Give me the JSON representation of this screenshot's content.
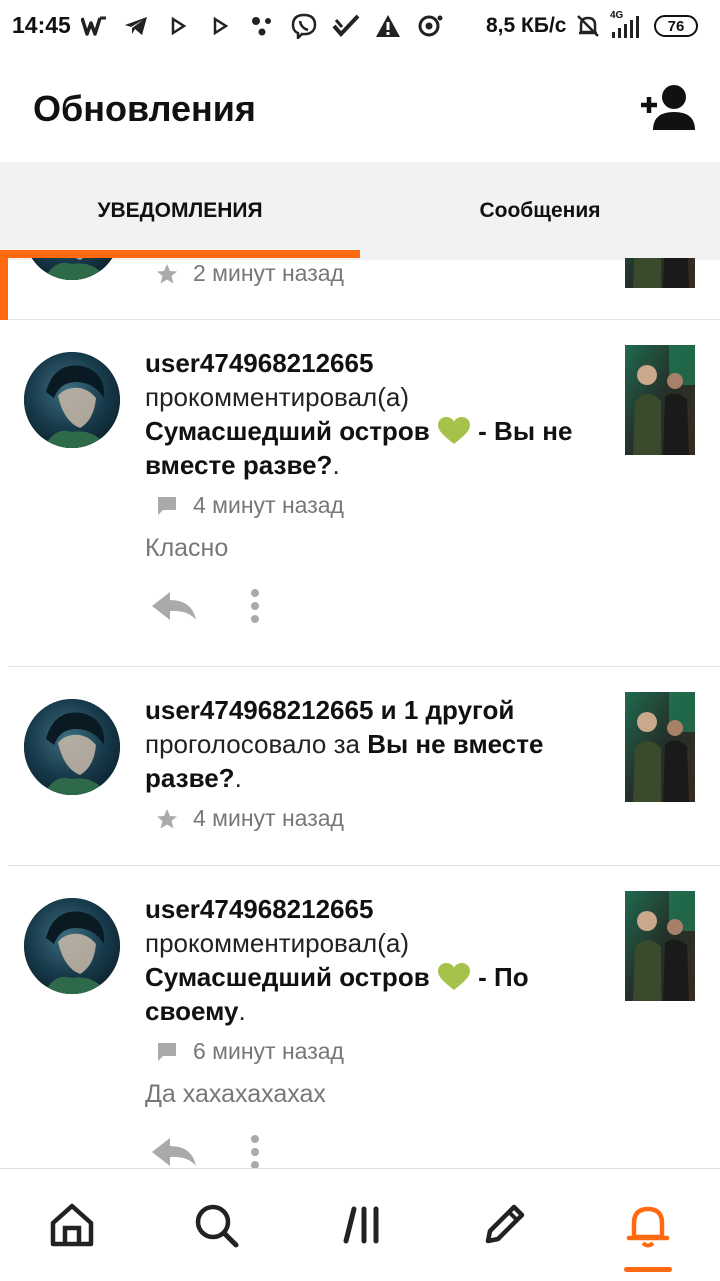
{
  "status_bar": {
    "time": "14:45",
    "speed": "8,5 КБ/с",
    "network": "4G",
    "battery": "76",
    "icons": [
      "w-icon",
      "telegram-icon",
      "play-icon",
      "play-icon",
      "dots-icon",
      "viber-icon",
      "vk-check-icon",
      "warning-icon",
      "record-icon"
    ]
  },
  "header": {
    "title": "Обновления",
    "action_icon": "add-user-icon"
  },
  "tabs": [
    {
      "label": "УВЕДОМЛЕНИЯ",
      "active": true
    },
    {
      "label": "Сообщения",
      "active": false
    }
  ],
  "colors": {
    "accent": "#ff6a10",
    "heart": "#a6c24a"
  },
  "notifications": [
    {
      "time": "2 минут назад",
      "meta_icon": "star-icon"
    },
    {
      "user": "user474968212665",
      "action": "прокомментировал(а)",
      "story": "Сумасшедший остров",
      "story_icon": "heart-icon",
      "chapter": " - Вы не вместе разве?",
      "end": ".",
      "time": "4 минут назад",
      "meta_icon": "comment-icon",
      "comment": "Класно"
    },
    {
      "user": "user474968212665 и 1 другой",
      "action": "проголосовало за",
      "chapter": "Вы не вместе разве?",
      "end": ".",
      "time": "4 минут назад",
      "meta_icon": "star-icon"
    },
    {
      "user": "user474968212665",
      "action": "прокомментировал(а)",
      "story": "Сумасшедший остров",
      "story_icon": "heart-icon",
      "chapter": " - По своему",
      "end": ".",
      "time": "6 минут назад",
      "meta_icon": "comment-icon",
      "comment": "Да хахахахахах"
    }
  ],
  "bottom_nav": [
    {
      "icon": "home-icon"
    },
    {
      "icon": "search-icon"
    },
    {
      "icon": "library-icon"
    },
    {
      "icon": "pencil-icon"
    },
    {
      "icon": "bell-icon",
      "active": true
    }
  ]
}
